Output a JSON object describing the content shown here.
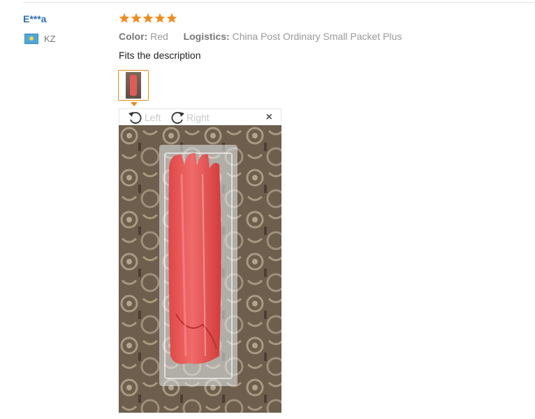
{
  "review": {
    "user_name": "E***a",
    "country_code": "KZ",
    "rating_stars": 5,
    "color_label": "Color:",
    "color_value": "Red",
    "logistics_label": "Logistics:",
    "logistics_value": "China Post Ordinary Small Packet Plus",
    "feedback_text": "Fits the description"
  },
  "viewer": {
    "rotate_left_label": "Left",
    "rotate_right_label": "Right",
    "close_symbol": "×"
  },
  "icons": {
    "star": "star-icon",
    "rotate_left": "rotate-left-icon",
    "rotate_right": "rotate-right-icon",
    "close": "close-icon",
    "flag": "kazakhstan-flag-icon"
  },
  "colors": {
    "star": "#f08c1e",
    "user_name": "#2f6fb5",
    "thumb_border": "#e78b1d"
  }
}
